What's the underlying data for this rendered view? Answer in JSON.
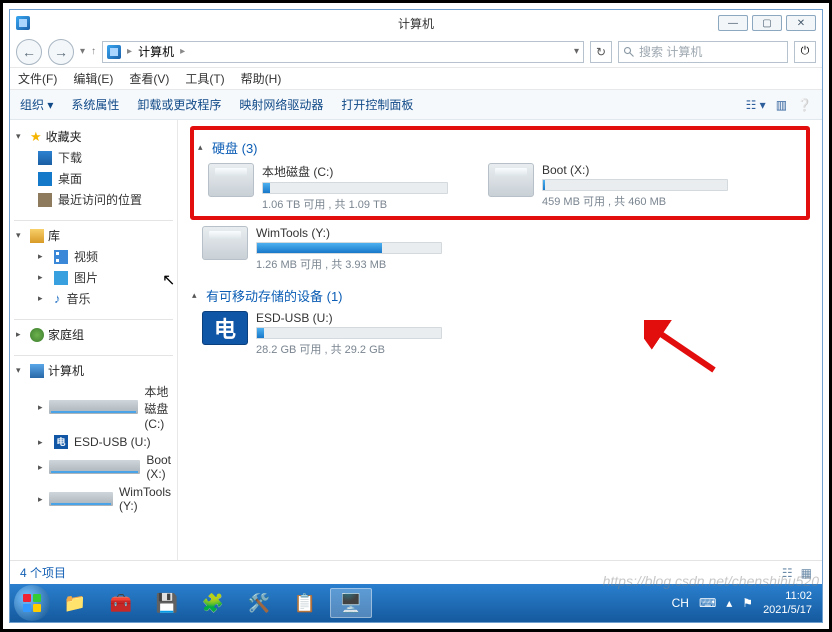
{
  "window": {
    "title": "计算机"
  },
  "titlebuttons": {
    "min": "—",
    "max": "▢",
    "close": "✕"
  },
  "nav": {
    "back": "←",
    "forward": "→",
    "up": "↑",
    "path_label": "计算机",
    "refresh": "↻"
  },
  "search": {
    "placeholder": "搜索 计算机"
  },
  "menu": {
    "file": "文件(F)",
    "edit": "编辑(E)",
    "view": "查看(V)",
    "tools": "工具(T)",
    "help": "帮助(H)"
  },
  "toolbar": {
    "organize": "组织",
    "sysprop": "系统属性",
    "uninstall": "卸载或更改程序",
    "netdrive": "映射网络驱动器",
    "ctrlpanel": "打开控制面板"
  },
  "sidebar": {
    "favorites": "收藏夹",
    "downloads": "下载",
    "desktop": "桌面",
    "recent": "最近访问的位置",
    "library": "库",
    "video": "视频",
    "pictures": "图片",
    "music": "音乐",
    "homegroup": "家庭组",
    "computer": "计算机",
    "drive_c": "本地磁盘 (C:)",
    "drive_u": "ESD-USB (U:)",
    "drive_x": "Boot (X:)",
    "drive_y": "WimTools (Y:)"
  },
  "content": {
    "hdd_header": "硬盘 (3)",
    "removable_header": "有可移动存储的设备 (1)",
    "drives": {
      "c": {
        "name": "本地磁盘 (C:)",
        "stat": "1.06 TB 可用 , 共 1.09 TB",
        "pct": 4
      },
      "x": {
        "name": "Boot (X:)",
        "stat": "459 MB 可用 , 共 460 MB",
        "pct": 1
      },
      "y": {
        "name": "WimTools (Y:)",
        "stat": "1.26 MB 可用 , 共 3.93 MB",
        "pct": 68
      },
      "u": {
        "name": "ESD-USB (U:)",
        "stat": "28.2 GB 可用 , 共 29.2 GB",
        "pct": 4
      }
    }
  },
  "status": {
    "items": "4 个项目"
  },
  "tray": {
    "ime": "CH",
    "time": "11:02",
    "date": "2021/5/17"
  },
  "watermark": "https://blog.csdn.net/chenshihu520"
}
